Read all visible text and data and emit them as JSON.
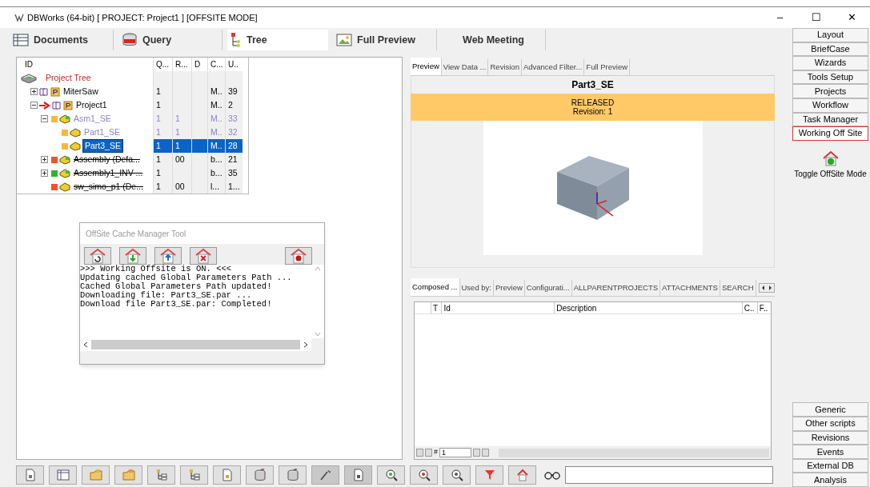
{
  "window": {
    "title": "DBWorks (64-bit) [ PROJECT: Project1 ] [OFFSITE MODE]",
    "controls": [
      "–",
      "☐",
      "✕"
    ]
  },
  "main_tabs": [
    {
      "label": "Documents",
      "selected": false,
      "kind": "documents"
    },
    {
      "label": "Query",
      "selected": false,
      "kind": "query"
    },
    {
      "label": "Tree",
      "selected": true,
      "kind": "tree"
    },
    {
      "label": "Full Preview",
      "selected": false,
      "kind": "preview"
    },
    {
      "label": "Web Meeting",
      "selected": false,
      "kind": "none"
    }
  ],
  "tree": {
    "columns": [
      "ID",
      "Q...",
      "R...",
      "D",
      "C...",
      "U.."
    ],
    "rows": [
      {
        "label": "Project Tree",
        "kind": "root",
        "cells": [
          "",
          "",
          "",
          "",
          ""
        ],
        "selected": false,
        "struck": false,
        "dimmed": false,
        "arrow": false,
        "children": [
          {
            "label": "MiterSaw",
            "kind": "project",
            "expanded": false,
            "cells": [
              "1",
              "",
              "",
              "M..",
              "39"
            ],
            "selected": false,
            "struck": false,
            "dimmed": false,
            "arrow": false
          },
          {
            "label": "Project1",
            "kind": "project",
            "expanded": true,
            "cells": [
              "1",
              "",
              "",
              "M..",
              "2"
            ],
            "selected": false,
            "struck": false,
            "dimmed": false,
            "arrow": true,
            "children": [
              {
                "label": "Asm1_SE",
                "kind": "assembly",
                "color": "#f5b942",
                "expanded": true,
                "cells": [
                  "1",
                  "1",
                  "",
                  "M..",
                  "33"
                ],
                "selected": false,
                "struck": false,
                "dimmed": true,
                "arrow": false,
                "children": [
                  {
                    "label": "Part1_SE",
                    "kind": "part",
                    "color": "#f5b942",
                    "cells": [
                      "1",
                      "1",
                      "",
                      "M..",
                      "32"
                    ],
                    "selected": false,
                    "struck": false,
                    "dimmed": true,
                    "arrow": false
                  },
                  {
                    "label": "Part3_SE",
                    "kind": "part",
                    "color": "#f5b942",
                    "cells": [
                      "1",
                      "1",
                      "",
                      "M..",
                      "28"
                    ],
                    "selected": true,
                    "struck": false,
                    "dimmed": false,
                    "arrow": false
                  }
                ]
              },
              {
                "label": "Assembly (Defa...",
                "kind": "assembly",
                "color": "#f0522a",
                "expanded": false,
                "cells": [
                  "1",
                  "00",
                  "",
                  "b...",
                  "21"
                ],
                "selected": false,
                "struck": true,
                "dimmed": false,
                "arrow": false
              },
              {
                "label": "Assembly1_INV ...",
                "kind": "assembly",
                "color": "#2fb52f",
                "expanded": false,
                "cells": [
                  "1",
                  "",
                  "",
                  "b...",
                  "35"
                ],
                "selected": false,
                "struck": true,
                "dimmed": false,
                "arrow": false
              },
              {
                "label": "sw_simo_p1 (De...",
                "kind": "part",
                "color": "#f0522a",
                "cells": [
                  "1",
                  "00",
                  "",
                  "l...",
                  "1..."
                ],
                "selected": false,
                "struck": true,
                "dimmed": false,
                "arrow": false
              }
            ]
          }
        ]
      }
    ]
  },
  "cache_tool": {
    "title": "OffSite Cache Manager Tool",
    "log": [
      ">>> Working Offsite is ON. <<<",
      "Updating cached Global Parameters Path ...",
      "Cached Global Parameters Path updated!",
      "Downloading file: Part3_SE.par ...",
      "Download file Part3_SE.par: Completed!"
    ]
  },
  "preview_tabs": [
    {
      "label": "Preview",
      "selected": true
    },
    {
      "label": "View Data ...",
      "selected": false
    },
    {
      "label": "Revision",
      "selected": false
    },
    {
      "label": "Advanced Filter...",
      "selected": false
    },
    {
      "label": "Full Preview",
      "selected": false
    }
  ],
  "preview": {
    "title": "Part3_SE",
    "status": "RELEASED",
    "revision": "Revision: 1"
  },
  "detail_tabs": [
    {
      "label": "Composed ...",
      "selected": true
    },
    {
      "label": "Used by:",
      "selected": false
    },
    {
      "label": "Preview",
      "selected": false
    },
    {
      "label": "Configurati...",
      "selected": false
    },
    {
      "label": "ALLPARENTPROJECTS",
      "selected": false
    },
    {
      "label": "ATTACHMENTS",
      "selected": false
    },
    {
      "label": "SEARCH",
      "selected": false
    }
  ],
  "detail_table": {
    "columns": [
      "T",
      "Id",
      "Description",
      "C..",
      "F.."
    ]
  },
  "pager": {
    "hash": "#",
    "page": "1"
  },
  "sidebar": {
    "top": [
      {
        "label": "Layout",
        "selected": false
      },
      {
        "label": "BriefCase",
        "selected": false
      },
      {
        "label": "Wizards",
        "selected": false
      },
      {
        "label": "Tools Setup",
        "selected": false
      },
      {
        "label": "Projects",
        "selected": false
      },
      {
        "label": "Workflow",
        "selected": false
      },
      {
        "label": "Task Manager",
        "selected": false
      },
      {
        "label": "Working Off Site",
        "selected": true
      }
    ],
    "toggle": "Toggle OffSite Mode",
    "bottom": [
      {
        "label": "Generic",
        "selected": false
      },
      {
        "label": "Other scripts",
        "selected": false
      },
      {
        "label": "Revisions",
        "selected": false
      },
      {
        "label": "Events",
        "selected": false
      },
      {
        "label": "External DB",
        "selected": false
      },
      {
        "label": "Analysis",
        "selected": false
      }
    ]
  }
}
